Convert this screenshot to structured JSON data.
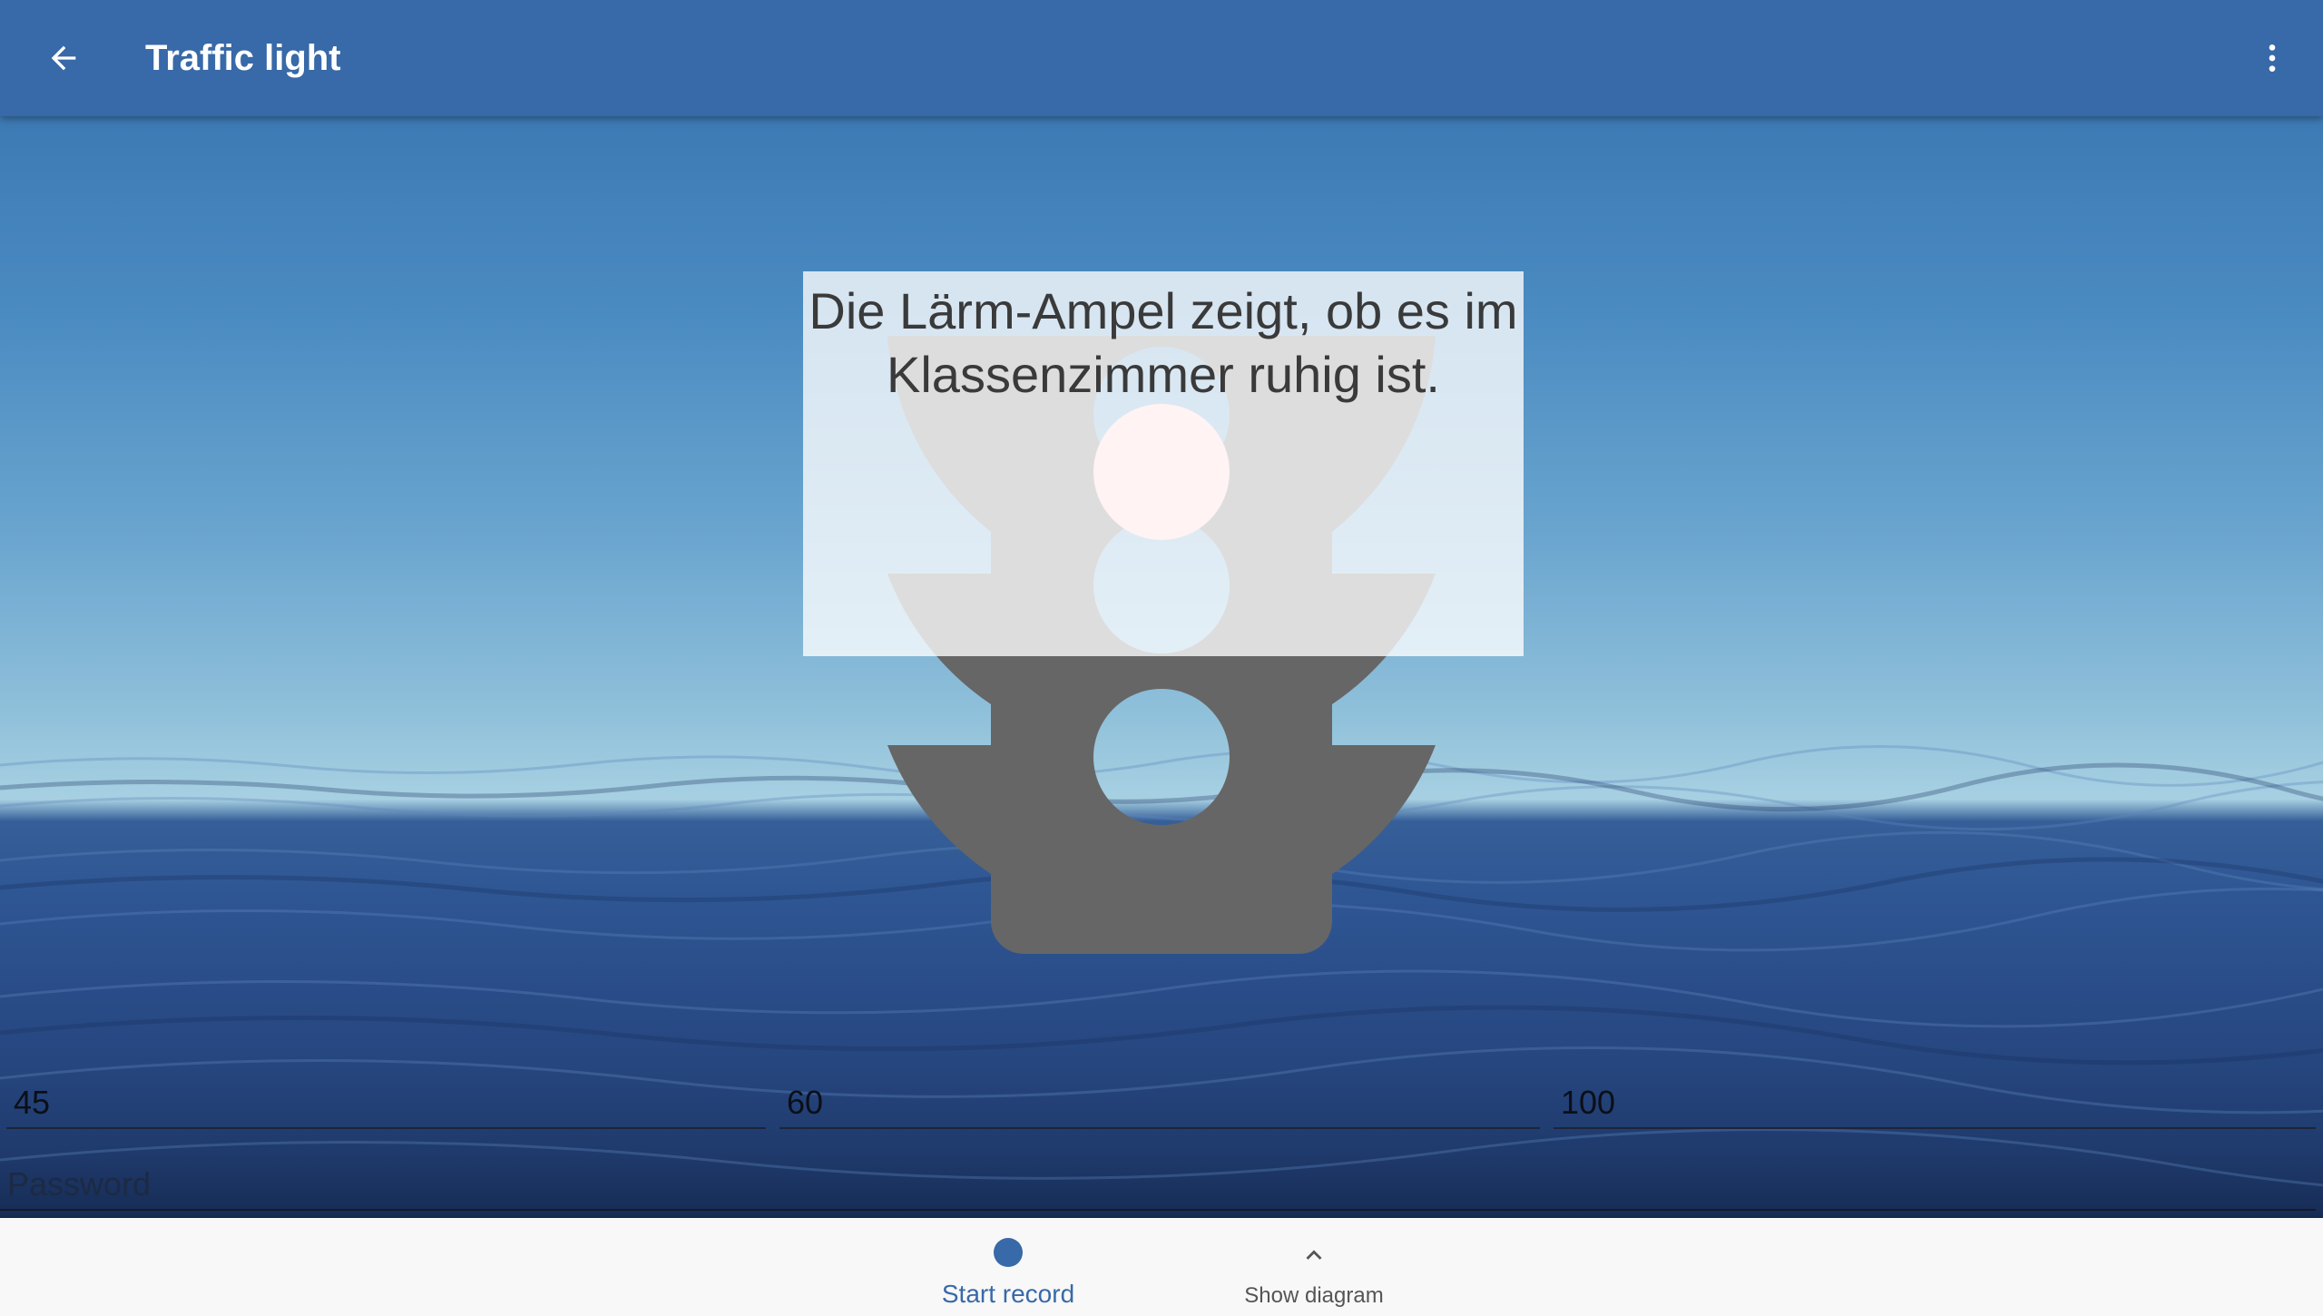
{
  "app_bar": {
    "title": "Traffic light",
    "background_color": "#3869a8",
    "back_icon": "arrow-back-icon",
    "menu_icon": "more-vert-icon"
  },
  "traffic_light": {
    "message": "Die Lärm-Ampel zeigt, ob es im Klassenzimmer ruhig ist.",
    "body_color": "#666666",
    "lamps": [
      {
        "name": "red",
        "state": "active",
        "color": "#ffc9c9"
      },
      {
        "name": "yellow",
        "state": "off"
      },
      {
        "name": "green",
        "state": "off"
      }
    ]
  },
  "thresholds": [
    {
      "value": "45"
    },
    {
      "value": "60"
    },
    {
      "value": "100"
    }
  ],
  "password": {
    "value": "",
    "placeholder": "Password"
  },
  "bottom_nav": {
    "start_record": {
      "label": "Start record",
      "icon": "record-dot-icon",
      "color": "#3869a8",
      "selected": true
    },
    "show_diagram": {
      "label": "Show diagram",
      "icon": "chevron-up-icon",
      "color": "#555555",
      "selected": false
    }
  }
}
